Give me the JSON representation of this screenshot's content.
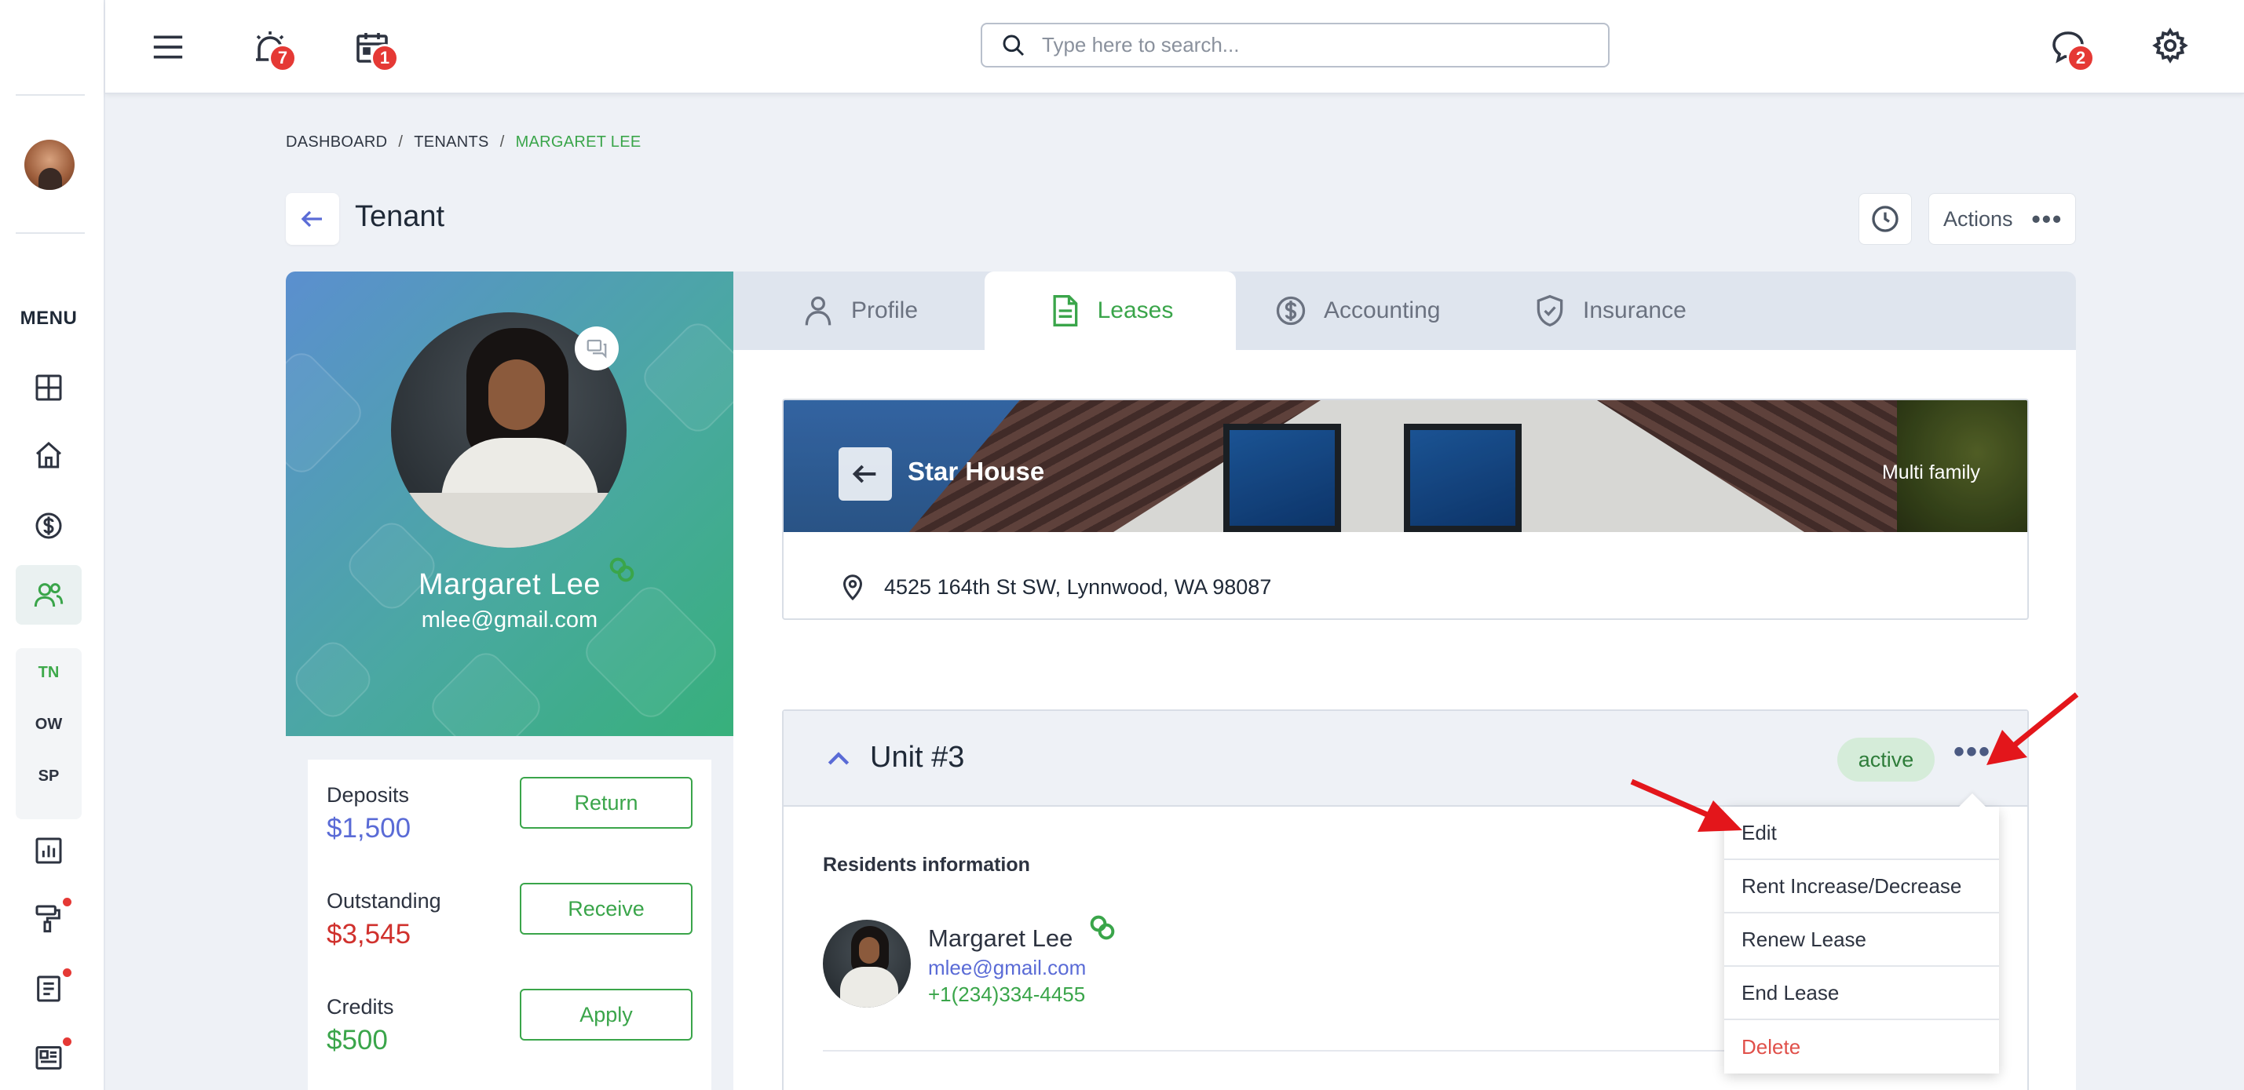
{
  "colors": {
    "accent_green": "#3aa54a",
    "accent_blue": "#5a6bd6",
    "danger_red": "#e53935",
    "outstanding_red": "#d0312d"
  },
  "sidebar": {
    "menu_label": "MENU",
    "items": [
      {
        "icon": "dashboard-icon"
      },
      {
        "icon": "home-icon"
      },
      {
        "icon": "dollar-icon"
      },
      {
        "icon": "users-icon",
        "active": true
      },
      {
        "icon": "report-chart-icon"
      },
      {
        "icon": "paint-roller-icon",
        "has_notification": true
      },
      {
        "icon": "document-icon",
        "has_notification": true
      },
      {
        "icon": "news-icon",
        "has_notification": true
      }
    ],
    "sub_items": [
      {
        "label": "TN",
        "active": true
      },
      {
        "label": "OW"
      },
      {
        "label": "SP"
      }
    ]
  },
  "topbar": {
    "alarm_badge": "7",
    "calendar_badge": "1",
    "chat_badge": "2",
    "search_placeholder": "Type here to search..."
  },
  "breadcrumb": [
    "DASHBOARD",
    "TENANTS",
    "MARGARET LEE"
  ],
  "header": {
    "title": "Tenant",
    "actions_label": "Actions"
  },
  "tenant": {
    "name": "Margaret Lee",
    "email": "mlee@gmail.com"
  },
  "balances": [
    {
      "label": "Deposits",
      "value": "$1,500",
      "button": "Return",
      "color": "#5a6bd6"
    },
    {
      "label": "Outstanding",
      "value": "$3,545",
      "button": "Receive",
      "color": "#d0312d"
    },
    {
      "label": "Credits",
      "value": "$500",
      "button": "Apply",
      "color": "#3aa54a"
    }
  ],
  "tabs": [
    {
      "label": "Profile",
      "icon": "person-icon"
    },
    {
      "label": "Leases",
      "icon": "lease-document-icon",
      "active": true
    },
    {
      "label": "Accounting",
      "icon": "dollar-circle-icon"
    },
    {
      "label": "Insurance",
      "icon": "shield-check-icon"
    }
  ],
  "property": {
    "name": "Star House",
    "type": "Multi family",
    "address": "4525 164th St SW, Lynnwood, WA 98087"
  },
  "unit": {
    "title": "Unit #3",
    "status": "active",
    "residents_label": "Residents information",
    "resident": {
      "name": "Margaret Lee",
      "email": "mlee@gmail.com",
      "phone": "+1(234)334-4455"
    }
  },
  "unit_menu": {
    "items": [
      "Edit",
      "Rent Increase/Decrease",
      "Renew Lease",
      "End Lease",
      "Delete"
    ]
  }
}
